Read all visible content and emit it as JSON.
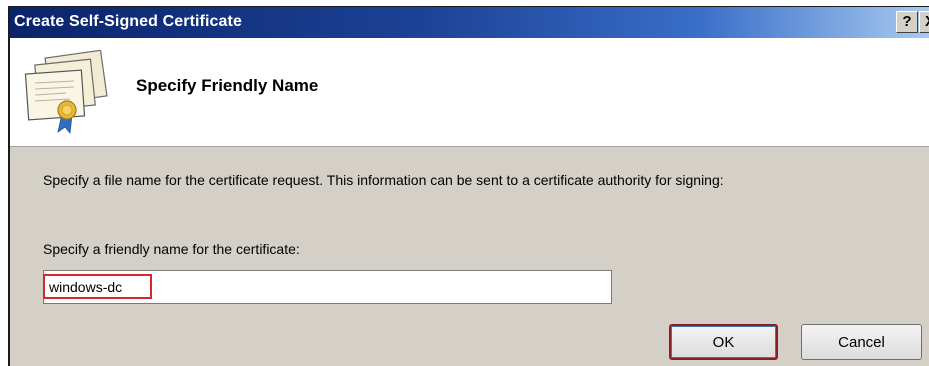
{
  "window": {
    "title": "Create Self-Signed Certificate",
    "help_label": "?",
    "close_label": "X"
  },
  "header": {
    "title": "Specify Friendly Name",
    "icon": "certificate-icon"
  },
  "main": {
    "description": "Specify a file name for the certificate request.  This information can be sent to a certificate authority for signing:",
    "field_label": "Specify a friendly name for the certificate:",
    "friendly_name_value": "windows-dc"
  },
  "buttons": {
    "ok_label": "OK",
    "cancel_label": "Cancel"
  },
  "colors": {
    "titlebar_start": "#0a246a",
    "titlebar_end": "#a6caf0",
    "dialog_background": "#d4d0c8",
    "highlight": "#d9262b"
  }
}
